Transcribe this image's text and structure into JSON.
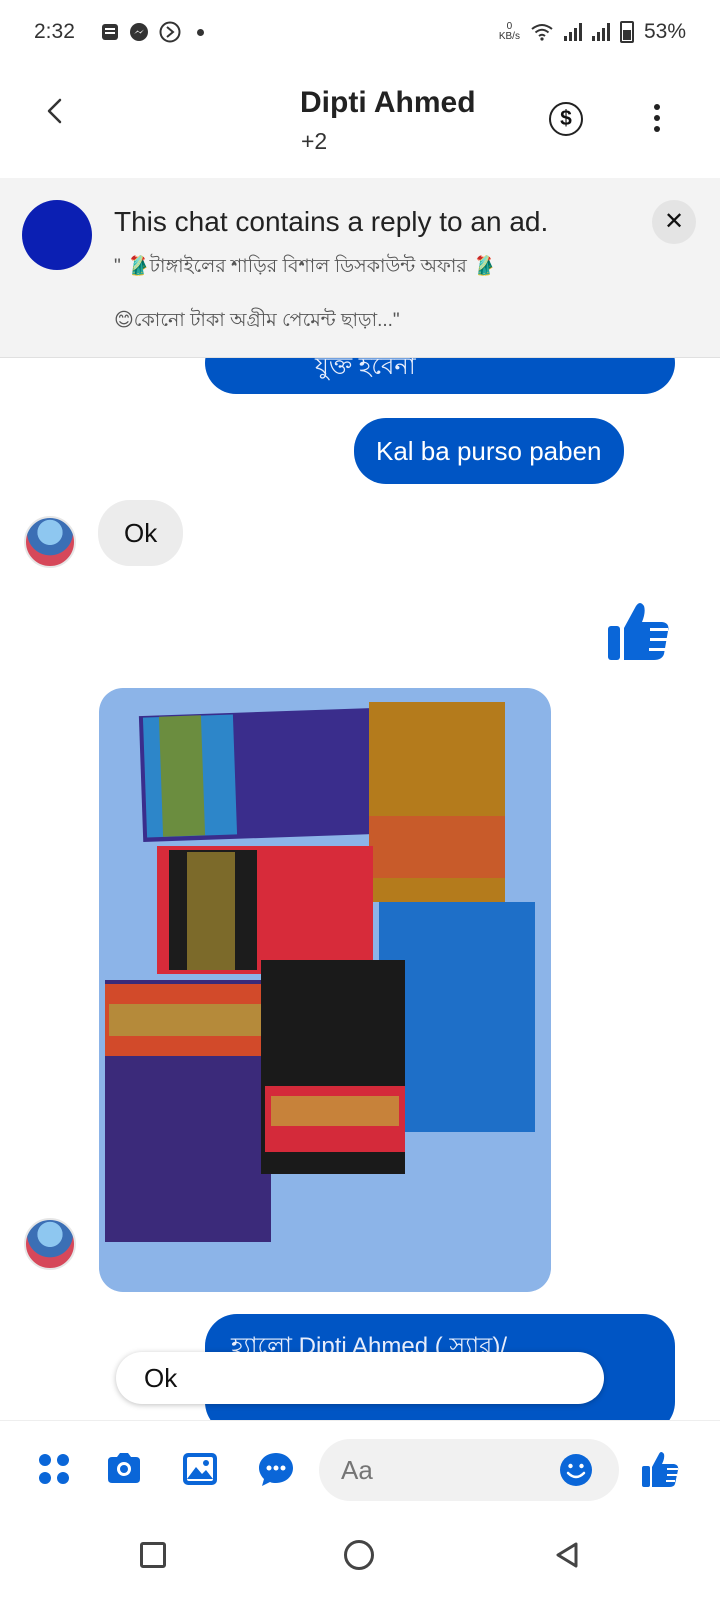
{
  "status_bar": {
    "time": "2:32",
    "net_speed_value": "0",
    "net_speed_unit": "KB/s",
    "battery": "53%"
  },
  "header": {
    "title": "Dipti Ahmed",
    "subtitle": "+2"
  },
  "ad_banner": {
    "title": "This chat contains a reply to an ad.",
    "line1": "\" 🥻টাঙ্গাইলের শাড়ির বিশাল ডিসকাউন্ট অফার 🥻",
    "line2": "😊কোনো টাকা অগ্রীম পেমেন্ট ছাড়া...\""
  },
  "chat": {
    "partial_top_text": "যুক্ত হবেনা",
    "message_out_1": "Kal ba purso paben",
    "message_in_1": "Ok",
    "partial_bottom_text": "হ্যালো Dipti Ahmed ( স্যার)/"
  },
  "quick_reply": "Ok",
  "composer": {
    "placeholder": "Aa"
  },
  "colors": {
    "brand_blue": "#0055c4",
    "icon_blue": "#0a66d8"
  }
}
